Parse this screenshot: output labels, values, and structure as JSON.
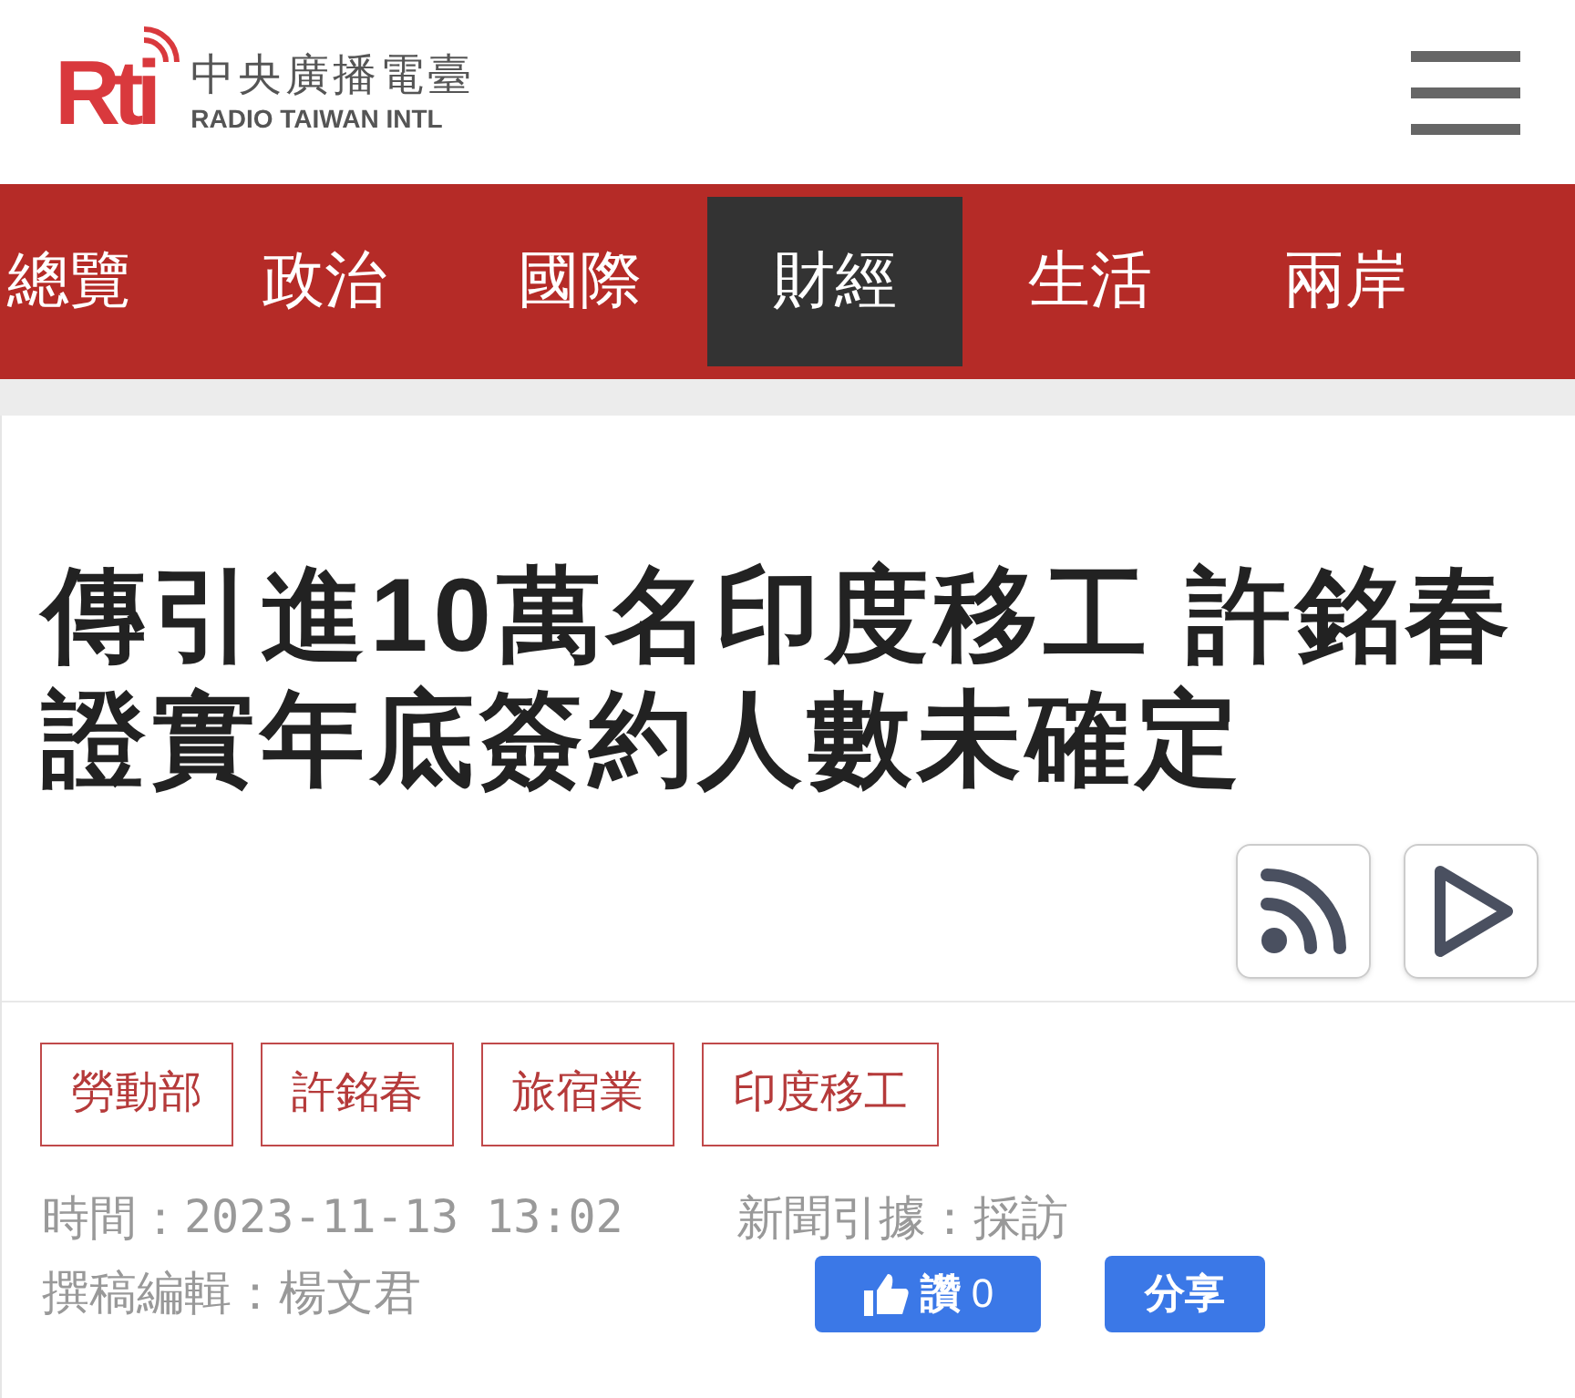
{
  "header": {
    "logo": "Rti",
    "logo_title": "中央廣播電臺",
    "logo_subtitle": "RADIO TAIWAN INTL"
  },
  "nav": [
    {
      "label": "總覽",
      "selected": false
    },
    {
      "label": "政治",
      "selected": false
    },
    {
      "label": "國際",
      "selected": false
    },
    {
      "label": "財經",
      "selected": true
    },
    {
      "label": "生活",
      "selected": false
    },
    {
      "label": "兩岸",
      "selected": false
    }
  ],
  "article": {
    "title": "傳引進10萬名印度移工 許銘春證實年底簽約人數未確定",
    "tags": [
      "勞動部",
      "許銘春",
      "旅宿業",
      "印度移工"
    ],
    "time_label": "時間：",
    "time": "2023-11-13 13:02",
    "source": "新聞引據：採訪",
    "editor": "撰稿編輯：楊文君",
    "like_label": "讚",
    "like_count": "0",
    "share": "分享"
  }
}
